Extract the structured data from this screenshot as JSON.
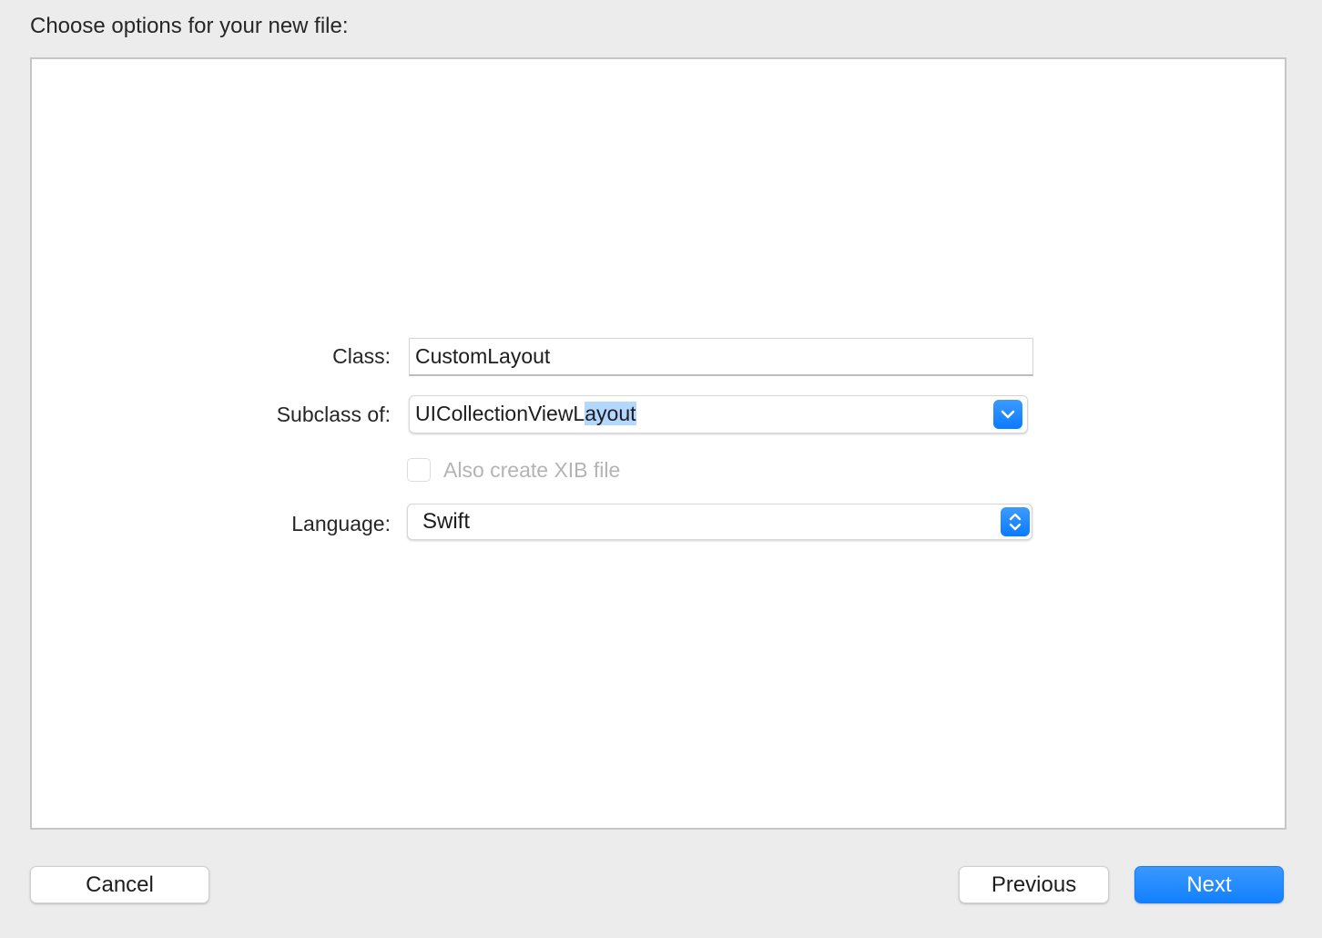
{
  "dialog": {
    "heading": "Choose options for your new file:"
  },
  "form": {
    "class_label": "Class:",
    "class_value": "CustomLayout",
    "subclass_label": "Subclass of:",
    "subclass_value_typed": "UICollectionViewL",
    "subclass_value_completed": "ayout",
    "xib_checkbox_label": "Also create XIB file",
    "xib_checkbox_checked": false,
    "xib_checkbox_enabled": false,
    "language_label": "Language:",
    "language_value": "Swift"
  },
  "icons": {
    "subclass_dropdown": "chevron-down-icon",
    "language_popup": "up-down-chevron-icon"
  },
  "buttons": {
    "cancel": "Cancel",
    "previous": "Previous",
    "next": "Next"
  },
  "colors": {
    "accent": "#0a7aff",
    "selection": "#b3d7ff"
  }
}
